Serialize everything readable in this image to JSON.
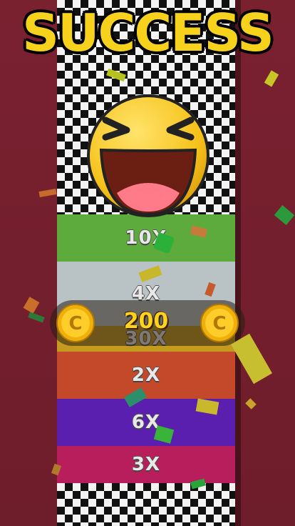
{
  "title": "SUCCESS",
  "reward": {
    "amount": "200",
    "coin_symbol": "C"
  },
  "multipliers": [
    "10X",
    "4X",
    "30X",
    "2X",
    "6X",
    "3X"
  ],
  "colors": {
    "title": "#f7d21d",
    "background": "#7a2130",
    "coin": "#f5b70d",
    "band_green": "#5daa3d",
    "band_orange": "#c4482a",
    "band_purple": "#5a1fae",
    "band_pink": "#b81e5c"
  }
}
